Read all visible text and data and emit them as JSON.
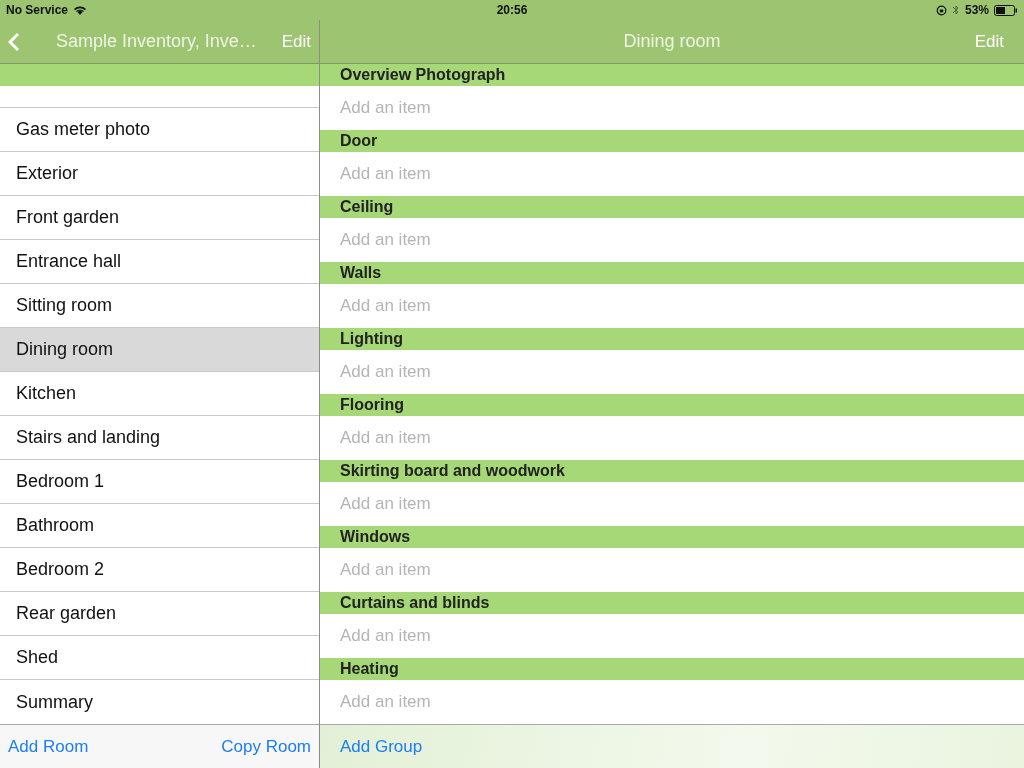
{
  "status_bar": {
    "carrier": "No Service",
    "time": "20:56",
    "battery": "53%"
  },
  "sidebar": {
    "title": "Sample Inventory, Inve…",
    "edit": "Edit",
    "rooms": [
      {
        "name": "Gas meter photo",
        "selected": false
      },
      {
        "name": "Exterior",
        "selected": false
      },
      {
        "name": "Front garden",
        "selected": false
      },
      {
        "name": "Entrance hall",
        "selected": false
      },
      {
        "name": "Sitting room",
        "selected": false
      },
      {
        "name": "Dining room",
        "selected": true
      },
      {
        "name": "Kitchen",
        "selected": false
      },
      {
        "name": "Stairs and landing",
        "selected": false
      },
      {
        "name": "Bedroom 1",
        "selected": false
      },
      {
        "name": "Bathroom",
        "selected": false
      },
      {
        "name": "Bedroom 2",
        "selected": false
      },
      {
        "name": "Rear garden",
        "selected": false
      },
      {
        "name": "Shed",
        "selected": false
      },
      {
        "name": "Summary",
        "selected": false
      }
    ],
    "toolbar": [
      "Add Room",
      "Copy Room"
    ]
  },
  "detail": {
    "title": "Dining room",
    "edit": "Edit",
    "groups": [
      {
        "name": "Overview Photograph",
        "placeholder": "Add an item"
      },
      {
        "name": "Door",
        "placeholder": "Add an item"
      },
      {
        "name": "Ceiling",
        "placeholder": "Add an item"
      },
      {
        "name": "Walls",
        "placeholder": "Add an item"
      },
      {
        "name": "Lighting",
        "placeholder": "Add an item"
      },
      {
        "name": "Flooring",
        "placeholder": "Add an item"
      },
      {
        "name": "Skirting board and woodwork",
        "placeholder": "Add an item"
      },
      {
        "name": "Windows",
        "placeholder": "Add an item"
      },
      {
        "name": "Curtains and blinds",
        "placeholder": "Add an item"
      },
      {
        "name": "Heating",
        "placeholder": "Add an item"
      }
    ],
    "toolbar": [
      "Add Group"
    ]
  }
}
